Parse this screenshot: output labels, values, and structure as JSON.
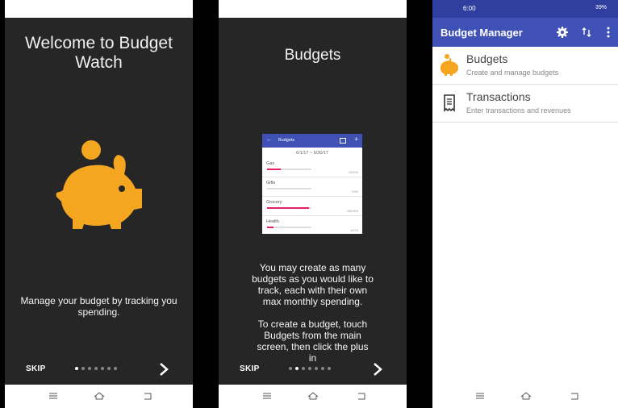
{
  "colors": {
    "accent": "#f4a620",
    "appbar": "#3f51b5",
    "statusbar": "#303f9f",
    "pink": "#e91e63"
  },
  "intro1": {
    "title": "Welcome to Budget Watch",
    "body": "Manage your budget by tracking you spending.",
    "skip": "SKIP",
    "page": 1,
    "pages": 7
  },
  "intro2": {
    "title": "Budgets",
    "body_1": "You may create as many budgets as you would like to track, each with their own max monthly spending.",
    "body_2": "To create a budget, touch Budgets from the main screen, then click the plus in",
    "skip": "SKIP",
    "page": 2,
    "pages": 7,
    "mini": {
      "title": "Budgets",
      "date_range": "6/1/17 ~ 6/30/17",
      "rows": [
        {
          "name": "Gas",
          "fill": 0.3,
          "amount": "10/100"
        },
        {
          "name": "Gifts",
          "fill": 0.0,
          "amount": "0/50"
        },
        {
          "name": "Grocery",
          "fill": 0.95,
          "amount": "285/300"
        },
        {
          "name": "Health",
          "fill": 0.15,
          "amount": "10/75"
        }
      ]
    }
  },
  "main": {
    "status": {
      "time": "6:00",
      "battery": "39%"
    },
    "app_title": "Budget Manager",
    "items": [
      {
        "title": "Budgets",
        "subtitle": "Create and manage budgets",
        "icon": "piggy-bank-icon"
      },
      {
        "title": "Transactions",
        "subtitle": "Enter transactions and revenues",
        "icon": "receipt-icon"
      }
    ]
  }
}
